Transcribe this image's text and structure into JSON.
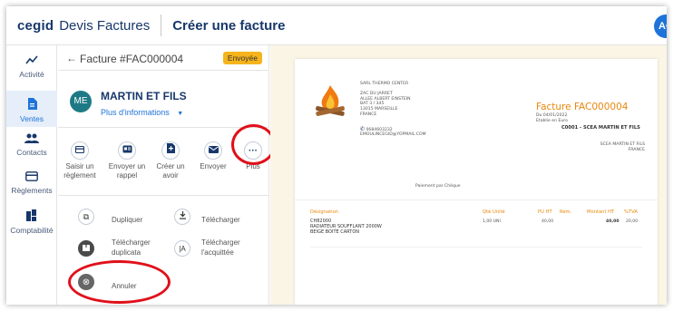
{
  "topbar": {
    "logo": "cegid",
    "app_name": "Devis Factures",
    "page_title": "Créer une facture",
    "avatar_initials": "AC"
  },
  "nav": {
    "items": [
      {
        "label": "Activité",
        "icon": "activity-icon"
      },
      {
        "label": "Ventes",
        "icon": "document-icon",
        "active": true
      },
      {
        "label": "Contacts",
        "icon": "contacts-icon"
      },
      {
        "label": "Règlements",
        "icon": "payment-icon"
      },
      {
        "label": "Comptabilité",
        "icon": "accounting-icon"
      }
    ]
  },
  "invoice": {
    "title": "Facture #FAC000004",
    "status": "Envoyée",
    "client_initials": "ME",
    "client_name": "MARTIN ET FILS",
    "more_info": "Plus d'informations"
  },
  "actions": [
    {
      "label1": "Saisir un",
      "label2": "règlement",
      "icon": "card-icon"
    },
    {
      "label1": "Envoyer un",
      "label2": "rappel",
      "icon": "reminder-icon"
    },
    {
      "label1": "Créer un",
      "label2": "avoir",
      "icon": "credit-note-icon"
    },
    {
      "label1": "Envoyer",
      "label2": "",
      "icon": "mail-icon"
    },
    {
      "label1": "Plus",
      "label2": "",
      "icon": "more-icon"
    }
  ],
  "more_menu": {
    "duplicate": "Dupliquer",
    "download": "Télécharger",
    "download_duplicate1": "Télécharger",
    "download_duplicate2": "duplicata",
    "download_paid1": "Télécharger",
    "download_paid2": "l'acquittée",
    "cancel": "Annuler"
  },
  "document": {
    "company_lines": "SARL THERMO CENTER\n\nZAC DU JARRET\nALLEE ALBERT EINSTEIN\nBAT 3 / 345\n13015 MARSEILLE\nFRANCE",
    "phone": "0684603232",
    "email": "EMOULINCEGID@YOPMAIL.COM",
    "invoice_number": "Facture FAC000004",
    "invoice_meta": "Du 04/01/2022\nEtablie en Euro",
    "client_ref": "C0001 - SCEA MARTIN ET FILS",
    "client_address": "SCEA MARTIN ET FILS\nFRANCE",
    "payment": "Paiement par Chèque",
    "headers": [
      "Désignation",
      "Qté Unité",
      "PU HT",
      "Rem.",
      "Montant HT",
      "%TVA"
    ],
    "line_code": "CH82000",
    "line_desc": "RADIATEUR SOUFFLANT 2000W\nBEIGE BOITE CARTON",
    "line_qty": "1,00 UNI",
    "line_pu": "40,00",
    "line_amount": "40,00",
    "line_tva": "20,00"
  },
  "colors": {
    "brand": "#17376a",
    "accent": "#1e73d8",
    "status_badge": "#f5b31c",
    "highlight": "#e0101a",
    "invoice_orange": "#e8870c"
  }
}
